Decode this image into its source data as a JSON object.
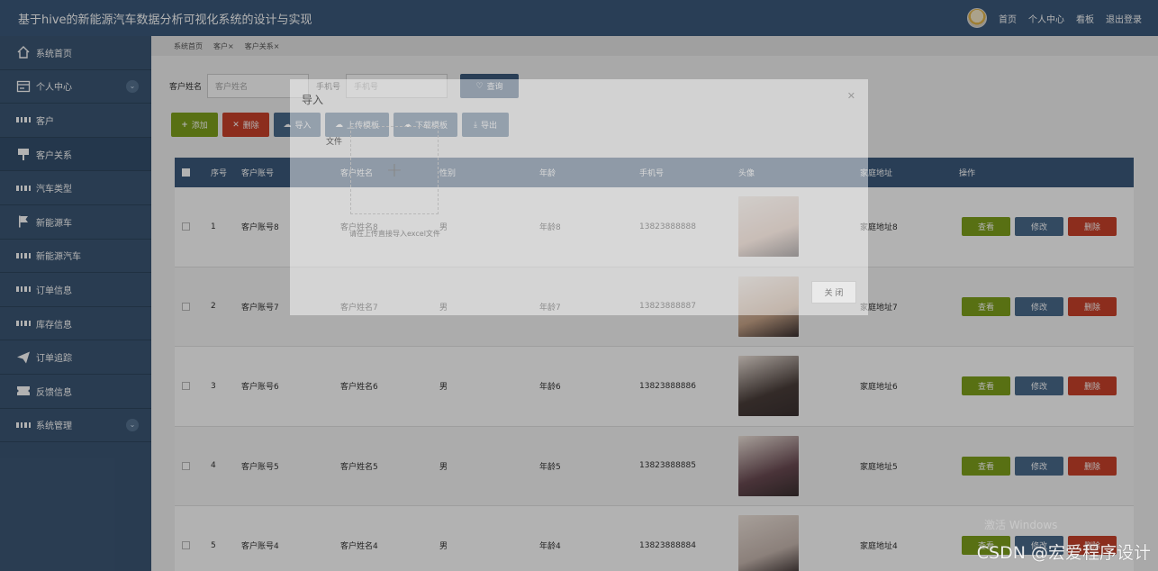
{
  "header": {
    "title": "基于hive的新能源汽车数据分析可视化系统的设计与实现",
    "nav": [
      "首页",
      "个人中心",
      "看板",
      "退出登录"
    ]
  },
  "sidebar": {
    "items": [
      {
        "label": "系统首页",
        "icon": "home-icon"
      },
      {
        "label": "个人中心",
        "icon": "user-card-icon",
        "expand": true
      },
      {
        "label": "客户",
        "icon": "grid-icon"
      },
      {
        "label": "客户关系",
        "icon": "sign-icon",
        "active": true
      },
      {
        "label": "汽车类型",
        "icon": "grid-icon"
      },
      {
        "label": "新能源车",
        "icon": "flag-icon"
      },
      {
        "label": "新能源汽车",
        "icon": "grid-icon"
      },
      {
        "label": "订单信息",
        "icon": "grid-icon"
      },
      {
        "label": "库存信息",
        "icon": "grid-icon"
      },
      {
        "label": "订单追踪",
        "icon": "send-icon"
      },
      {
        "label": "反馈信息",
        "icon": "ticket-icon"
      },
      {
        "label": "系统管理",
        "icon": "grid-icon",
        "expand": true
      }
    ]
  },
  "breadcrumbs": [
    "系统首页",
    "客户×",
    "客户关系×"
  ],
  "search": {
    "name_label": "客户姓名",
    "name_placeholder": "客户姓名",
    "phone_label": "手机号",
    "phone_placeholder": "手机号",
    "query_label": "查询"
  },
  "toolbar": {
    "add": "添加",
    "delete": "删除",
    "import": "导入",
    "upload_template": "上传模板",
    "download_template": "下载模板",
    "export": "导出"
  },
  "table": {
    "columns": [
      "序号",
      "客户账号",
      "客户姓名",
      "性别",
      "年龄",
      "手机号",
      "头像",
      "家庭地址",
      "操作"
    ],
    "rows": [
      {
        "no": "1",
        "account": "客户账号8",
        "name": "客户姓名8",
        "gender": "男",
        "age": "年龄8",
        "phone": "13823888888",
        "address": "家庭地址8",
        "photo_color": "#d8b9a8"
      },
      {
        "no": "2",
        "account": "客户账号7",
        "name": "客户姓名7",
        "gender": "男",
        "age": "年龄7",
        "phone": "13823888887",
        "address": "家庭地址7",
        "photo_color": "#caa68a"
      },
      {
        "no": "3",
        "account": "客户账号6",
        "name": "客户姓名6",
        "gender": "男",
        "age": "年龄6",
        "phone": "13823888886",
        "address": "家庭地址6",
        "photo_color": "#4a3e3a"
      },
      {
        "no": "4",
        "account": "客户账号5",
        "name": "客户姓名5",
        "gender": "男",
        "age": "年龄5",
        "phone": "13823888885",
        "address": "家庭地址5",
        "photo_color": "#6a4a52"
      },
      {
        "no": "5",
        "account": "客户账号4",
        "name": "客户姓名4",
        "gender": "男",
        "age": "年龄4",
        "phone": "13823888884",
        "address": "家庭地址4",
        "photo_color": "#c8b8b0"
      }
    ],
    "actions": {
      "view": "查看",
      "edit": "修改",
      "delete": "删除"
    }
  },
  "modal": {
    "title": "导入",
    "file_label": "文件",
    "hint": "请在上传直接导入excel文件",
    "close_label": "关 闭"
  },
  "watermark": "CSDN @宏爱程序设计",
  "windows_mark": "激活 Windows"
}
